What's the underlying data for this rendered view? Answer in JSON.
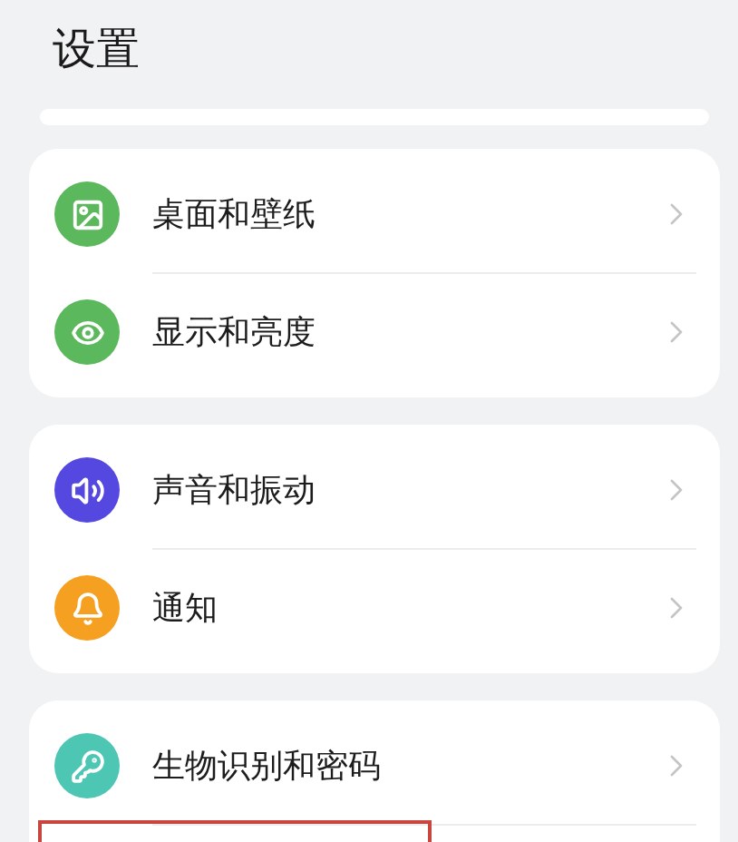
{
  "title": "设置",
  "groups": [
    {
      "items": [
        {
          "label": "桌面和壁纸",
          "kind": "picture",
          "color": "#5cb85c"
        },
        {
          "label": "显示和亮度",
          "kind": "eye",
          "color": "#5cb85c"
        }
      ]
    },
    {
      "items": [
        {
          "label": "声音和振动",
          "kind": "speaker",
          "color": "#5548e0"
        },
        {
          "label": "通知",
          "kind": "bell",
          "color": "#f5a020"
        }
      ]
    },
    {
      "continues": true,
      "items": [
        {
          "label": "生物识别和密码",
          "kind": "key",
          "color": "#4ec6b4"
        }
      ]
    }
  ],
  "highlight_frame": true
}
